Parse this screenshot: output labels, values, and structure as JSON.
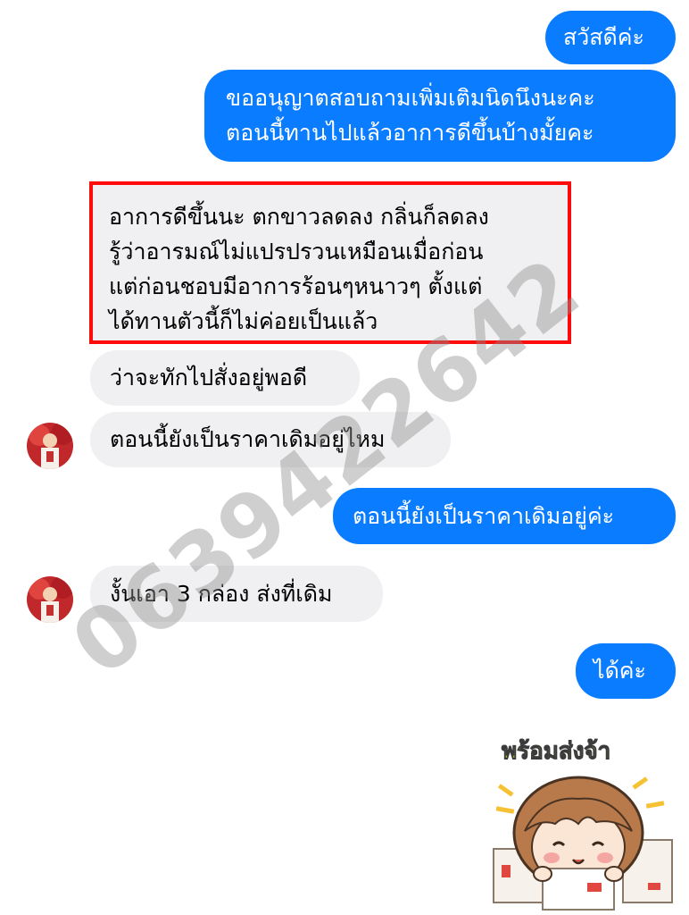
{
  "messages": {
    "m1": "สวัสดีค่ะ",
    "m2": "ขออนุญาตสอบถามเพิ่มเติมนิดนึงนะคะ\nตอนนี้ทานไปแล้วอาการดีขึ้นบ้างมั้ยคะ",
    "m3": "อาการดีขึ้นนะ ตกขาวลดลง กลิ่นก็ลดลง\nรู้ว่าอารมณ์ไม่แปรปรวนเหมือนเมื่อก่อน\nแต่ก่อนชอบมีอาการร้อนๆหนาวๆ ตั้งแต่\nได้ทานตัวนี้ก็ไม่ค่อยเป็นแล้ว",
    "m4": "ว่าจะทักไปสั่งอยู่พอดี",
    "m5": "ตอนนี้ยังเป็นราคาเดิมอยู่ไหม",
    "m6": "ตอนนี้ยังเป็นราคาเดิมอยู่ค่ะ",
    "m7": "งั้นเอา 3 กล่อง ส่งที่เดิม",
    "m8": "ได้ค่ะ"
  },
  "sticker": {
    "title": "พร้อมส่งจ้า"
  },
  "watermark": {
    "text": "0639422642"
  },
  "colors": {
    "outgoing": "#0A7CFF",
    "incoming": "#F0F0F2",
    "highlight_border": "#FF0A0A"
  }
}
